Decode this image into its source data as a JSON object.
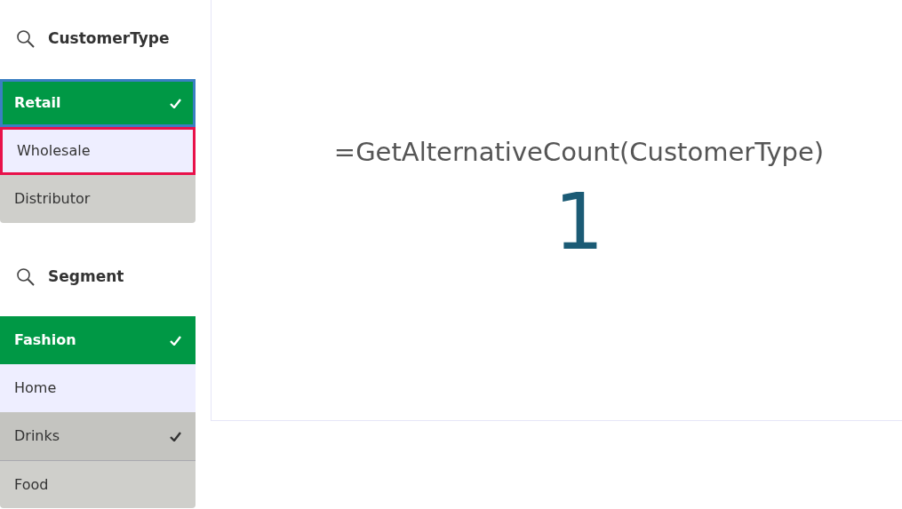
{
  "filters": [
    {
      "title": "CustomerType",
      "items": [
        {
          "label": "Retail",
          "selected": true,
          "excluded": false,
          "focused": true,
          "hovered": false
        },
        {
          "label": "Wholesale",
          "selected": false,
          "excluded": false,
          "focused": false,
          "hovered": true
        },
        {
          "label": "Distributor",
          "selected": false,
          "excluded": true,
          "focused": false,
          "hovered": false
        }
      ]
    },
    {
      "title": "Segment",
      "items": [
        {
          "label": "Fashion",
          "selected": true,
          "excluded": false,
          "focused": false,
          "hovered": false
        },
        {
          "label": "Home",
          "selected": false,
          "excluded": false,
          "focused": false,
          "hovered": false
        },
        {
          "label": "Drinks",
          "selected": true,
          "excluded": true,
          "focused": false,
          "hovered": false
        },
        {
          "label": "Food",
          "selected": false,
          "excluded": true,
          "focused": false,
          "hovered": false
        }
      ]
    }
  ],
  "kpi": {
    "formula": "=GetAlternativeCount(CustomerType)",
    "value": "1"
  }
}
